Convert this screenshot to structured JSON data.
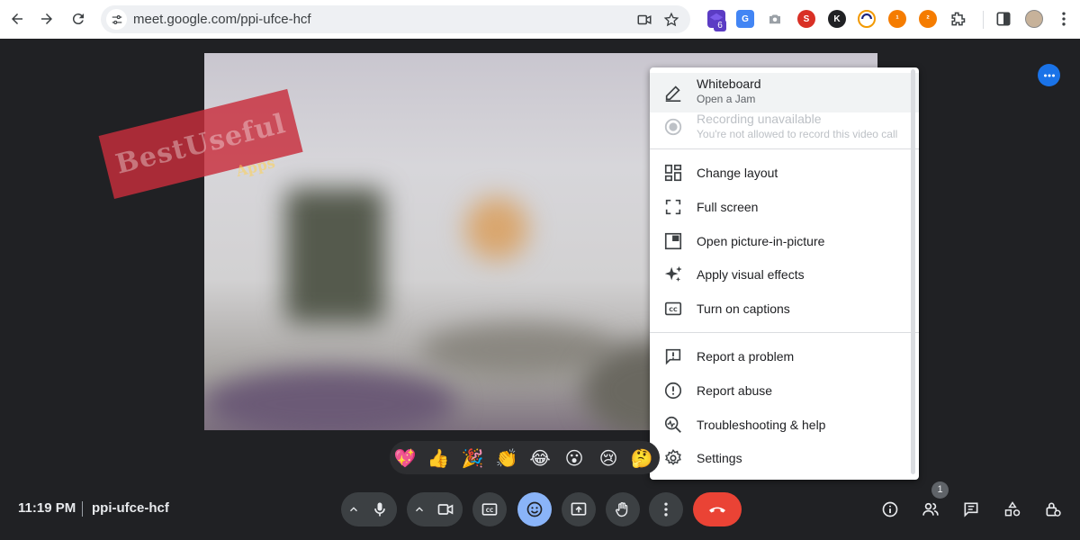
{
  "browser": {
    "url": "meet.google.com/ppi-ufce-hcf",
    "extension_badge": "6",
    "icons": [
      "back-icon",
      "forward-icon",
      "reload-icon",
      "tune-icon",
      "video-camera-icon",
      "star-icon",
      "extensions-icon",
      "sidepanel-icon",
      "kebab-icon"
    ]
  },
  "watermark": {
    "text": "BestUseful",
    "sub": "Apps"
  },
  "menu": {
    "whiteboard": {
      "label": "Whiteboard",
      "sub": "Open a Jam"
    },
    "recording": {
      "label": "Recording unavailable",
      "sub": "You're not allowed to record this video call"
    },
    "items_group1": [
      {
        "label": "Change layout",
        "icon": "layout-icon"
      },
      {
        "label": "Full screen",
        "icon": "fullscreen-icon"
      },
      {
        "label": "Open picture-in-picture",
        "icon": "pip-icon"
      },
      {
        "label": "Apply visual effects",
        "icon": "sparkle-icon"
      },
      {
        "label": "Turn on captions",
        "icon": "captions-icon"
      }
    ],
    "items_group2": [
      {
        "label": "Report a problem",
        "icon": "feedback-icon"
      },
      {
        "label": "Report abuse",
        "icon": "alert-icon"
      },
      {
        "label": "Troubleshooting & help",
        "icon": "troubleshoot-icon"
      },
      {
        "label": "Settings",
        "icon": "settings-icon"
      }
    ]
  },
  "emojis": [
    "💖",
    "👍",
    "🎉",
    "👏",
    "😂",
    "😮",
    "😢",
    "🤔"
  ],
  "bottom": {
    "time": "11:19 PM",
    "meeting_code": "ppi-ufce-hcf",
    "participants_count": "1"
  },
  "colors": {
    "accent": "#1a73e8",
    "hangup": "#ea4335",
    "background": "#202124",
    "control": "#3c4043"
  }
}
